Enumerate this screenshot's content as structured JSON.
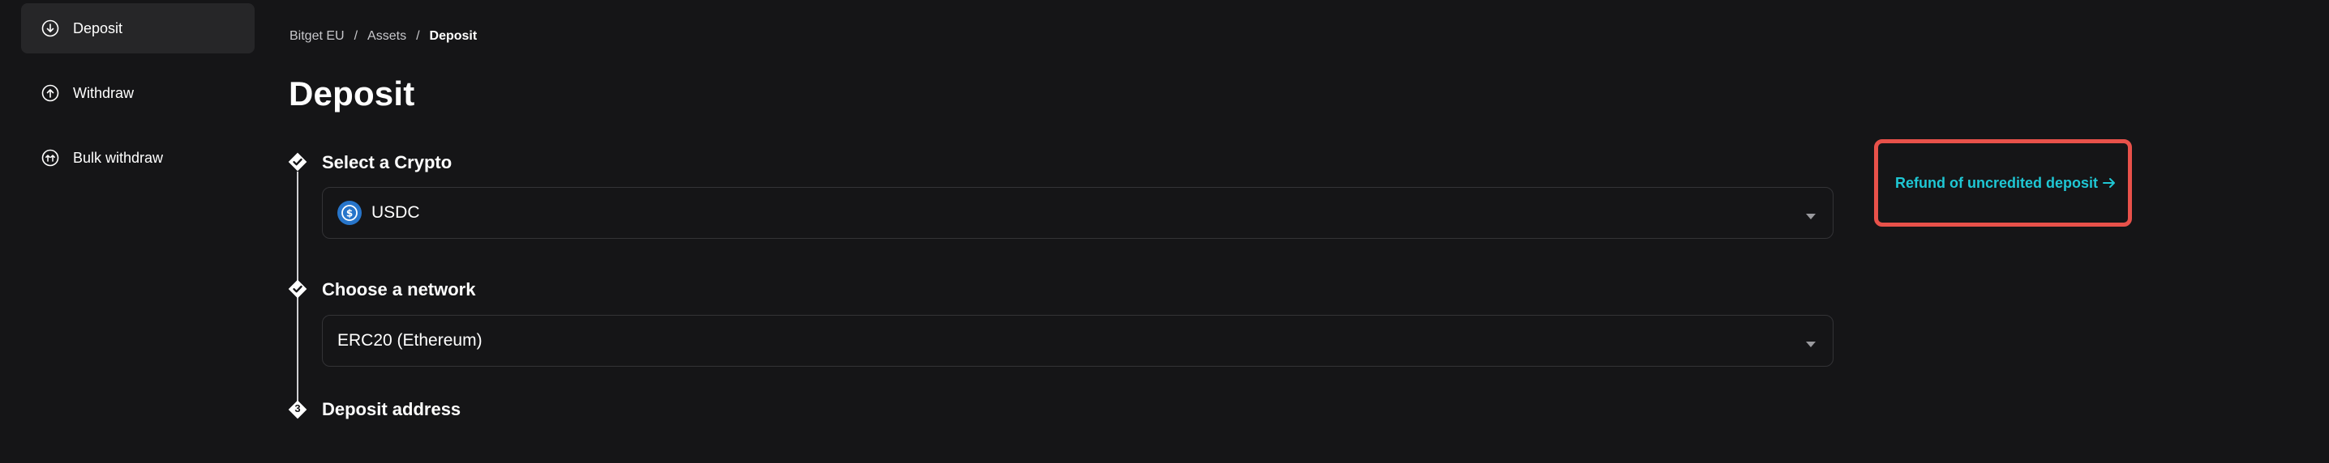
{
  "sidebar": {
    "items": [
      {
        "label": "Deposit",
        "icon": "arrow-down-circle-icon",
        "active": true
      },
      {
        "label": "Withdraw",
        "icon": "arrow-up-circle-icon",
        "active": false
      },
      {
        "label": "Bulk withdraw",
        "icon": "double-arrow-up-circle-icon",
        "active": false
      }
    ]
  },
  "breadcrumb": {
    "items": [
      "Bitget EU",
      "Assets"
    ],
    "separator": "/",
    "current": "Deposit"
  },
  "page": {
    "title": "Deposit"
  },
  "steps": {
    "select_crypto": {
      "title": "Select a Crypto",
      "value": "USDC",
      "coin_icon": "usdc-icon",
      "status": "done"
    },
    "choose_network": {
      "title": "Choose a network",
      "value": "ERC20 (Ethereum)",
      "status": "done"
    },
    "deposit_address": {
      "title": "Deposit address",
      "number": "3",
      "status": "current"
    }
  },
  "refund": {
    "label": "Refund of uncredited deposit",
    "highlight_color": "#e8514a",
    "link_color": "#1fc7d4"
  }
}
